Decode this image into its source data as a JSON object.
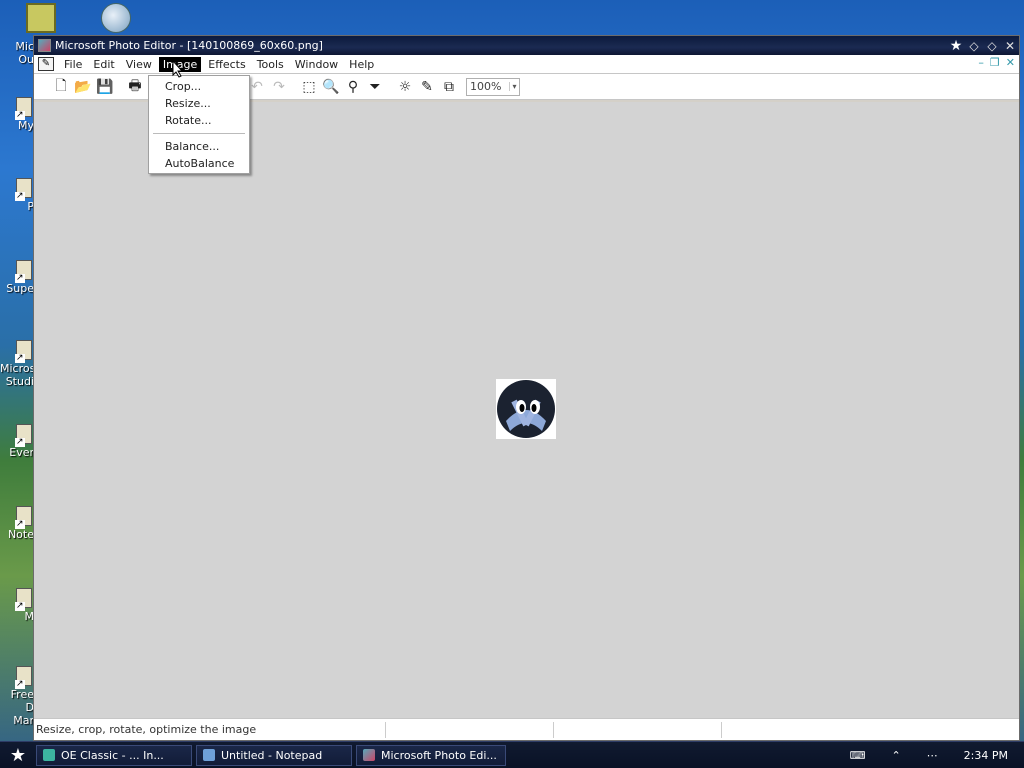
{
  "window": {
    "title": "Microsoft Photo Editor - [140100869_60x60.png]"
  },
  "menubar": {
    "items": [
      {
        "label": "File"
      },
      {
        "label": "Edit"
      },
      {
        "label": "View"
      },
      {
        "label": "Image"
      },
      {
        "label": "Effects"
      },
      {
        "label": "Tools"
      },
      {
        "label": "Window"
      },
      {
        "label": "Help"
      }
    ]
  },
  "toolbar": {
    "zoom": "100%"
  },
  "image_menu": {
    "items": [
      {
        "label": "Crop..."
      },
      {
        "label": "Resize..."
      },
      {
        "label": "Rotate..."
      },
      {
        "label": "Balance..."
      },
      {
        "label": "AutoBalance"
      }
    ]
  },
  "statusbar": {
    "text": "Resize, crop, rotate, optimize the image"
  },
  "desktop": {
    "icons": [
      {
        "label": "Mic\nOu"
      },
      {
        "label": "My"
      },
      {
        "label": "P"
      },
      {
        "label": "Supe"
      },
      {
        "label": "Microso\nStudi"
      },
      {
        "label": "Ever"
      },
      {
        "label": "Note"
      },
      {
        "label": "M"
      },
      {
        "label": "Free D\nMar"
      }
    ]
  },
  "taskbar": {
    "tasks": [
      {
        "label": "OE Classic - ... In..."
      },
      {
        "label": "Untitled - Notepad"
      },
      {
        "label": "Microsoft Photo Edi..."
      }
    ],
    "clock": "2:34 PM"
  },
  "colors": {
    "titlebar": "#0c1a3c",
    "workspace": "#d3d3d3",
    "menu_active": "#000000",
    "taskbar": "#101a30"
  }
}
